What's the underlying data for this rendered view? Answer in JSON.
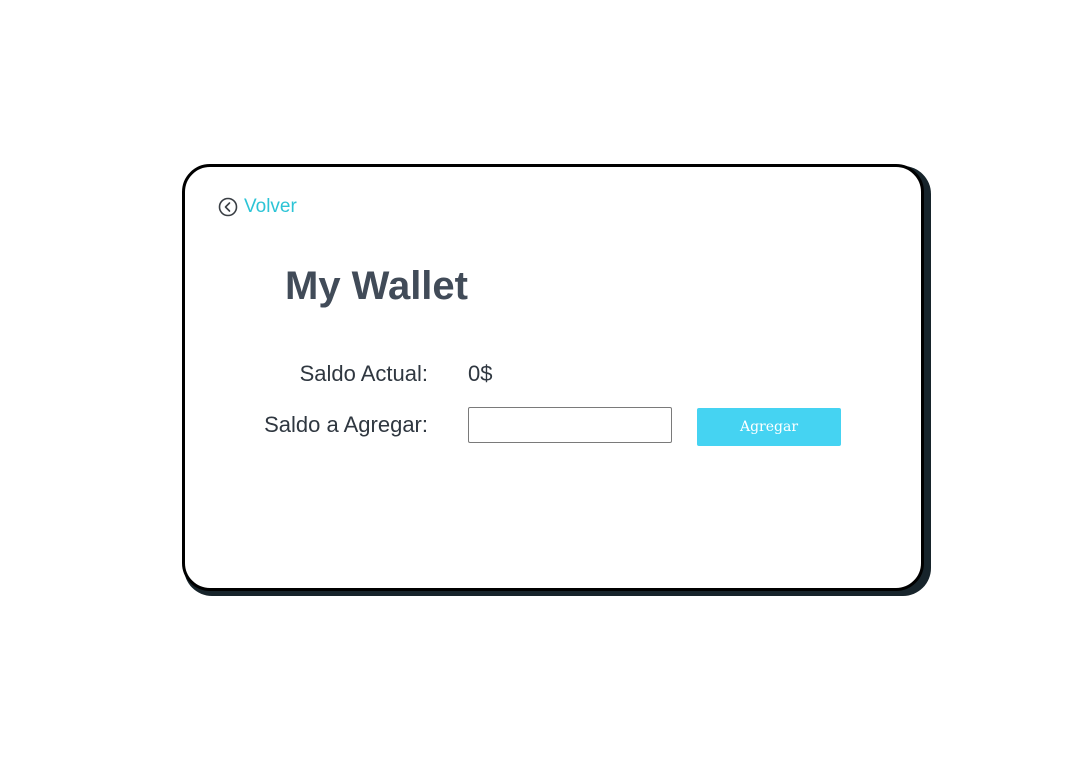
{
  "navigation": {
    "back_label": "Volver",
    "back_icon": "chevron-left-circle-icon"
  },
  "wallet": {
    "title": "My Wallet",
    "current_balance_label": "Saldo Actual:",
    "current_balance_value": "0$",
    "add_balance_label": "Saldo a Agregar:",
    "add_balance_input_value": "",
    "add_button_label": "Agregar"
  },
  "colors": {
    "accent": "#2cc4d6",
    "button": "#45d3f2",
    "title": "#414b58",
    "text": "#2f3740",
    "card_border": "#000000",
    "card_shadow": "#17242b"
  }
}
